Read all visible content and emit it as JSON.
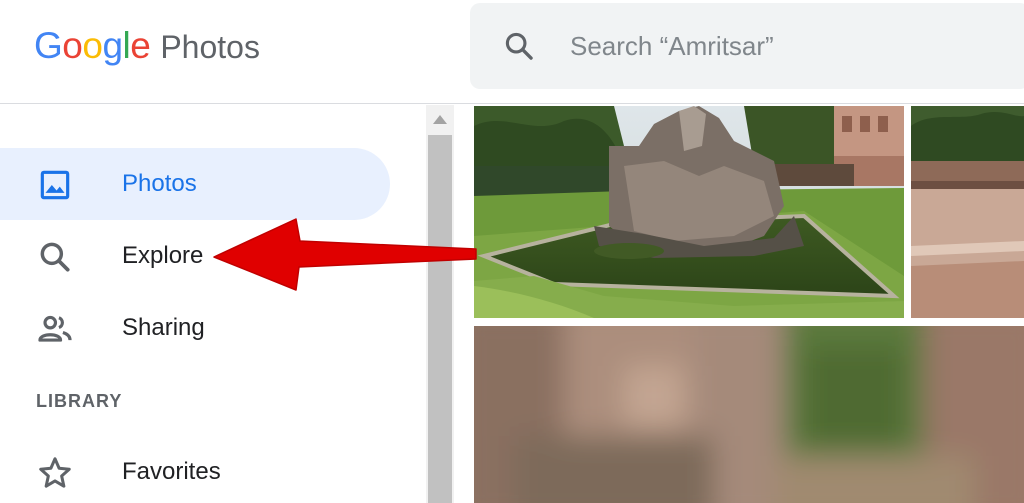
{
  "app": {
    "logo_letters": [
      {
        "char": "G",
        "color": "#4285F4"
      },
      {
        "char": "o",
        "color": "#EA4335"
      },
      {
        "char": "o",
        "color": "#FBBC05"
      },
      {
        "char": "g",
        "color": "#4285F4"
      },
      {
        "char": "l",
        "color": "#34A853"
      },
      {
        "char": "e",
        "color": "#EA4335"
      }
    ],
    "product_name": "Photos"
  },
  "search": {
    "icon": "search-icon",
    "placeholder": "Search “Amritsar”"
  },
  "sidebar": {
    "items": [
      {
        "label": "Photos",
        "icon": "photo-icon",
        "active": true
      },
      {
        "label": "Explore",
        "icon": "search-icon",
        "active": false
      },
      {
        "label": "Sharing",
        "icon": "people-icon",
        "active": false
      }
    ],
    "section_label": "LIBRARY",
    "library_items": [
      {
        "label": "Favorites",
        "icon": "star-icon"
      }
    ]
  },
  "colors": {
    "accent": "#1a73e8",
    "active_bg": "#e8f0fe",
    "annotation_arrow": "#e00000"
  },
  "photos": [
    {
      "name": "garden-fountain-photo"
    },
    {
      "name": "courtyard-photo"
    },
    {
      "name": "blurred-photo"
    }
  ]
}
